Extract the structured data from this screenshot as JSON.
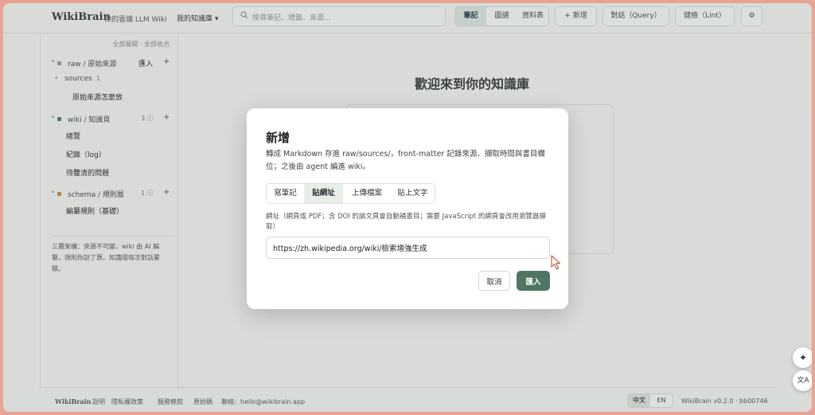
{
  "header": {
    "brand": "WikiBrain",
    "brand_sub": "你的雲端 LLM Wiki",
    "kb_select": "我的知識庫 ▾",
    "search_placeholder": "搜尋筆記、標籤、來源...",
    "views": [
      "筆記",
      "圖譜",
      "資料表"
    ],
    "add": "+ 新增",
    "chat": "對話（Query）",
    "lint": "健檢（Lint）",
    "settings_icon": "gear-icon"
  },
  "sidebar": {
    "expand_all": "全部展開",
    "collapse_all": "全部收合",
    "sep": "·",
    "raw": {
      "label": "raw / 原始來源",
      "count": "1",
      "action": "匯入",
      "color": "#9a9a9a"
    },
    "sources": {
      "label": "sources",
      "count": "1"
    },
    "raw_item": "原始來源怎麼放",
    "wiki": {
      "label": "wiki / 知識頁",
      "count": "3 ⓘ",
      "color": "#4e7663"
    },
    "wiki_items": [
      "總覽",
      "紀錄（log）",
      "待釐清的問題"
    ],
    "schema": {
      "label": "schema / 規則層",
      "count": "1 ⓘ",
      "color": "#c88a3e"
    },
    "schema_item": "編纂規則（基礎）",
    "note": "三層架構：來源不可變，wiki 由 AI 編纂，規則你說了算。知識隨每次對話累積。"
  },
  "main": {
    "welcome": "歡迎來到你的知識庫"
  },
  "footer": {
    "brand": "WikiBrain",
    "links": [
      "說明",
      "隱私權政策",
      "服務條款",
      "原始碼",
      "聯絡：hello@wikibrain.app"
    ],
    "lang": [
      "中文",
      "EN"
    ],
    "version": "WikiBrain v0.2.0 · bb00746"
  },
  "fabs": {
    "sparkle_icon": "✦",
    "translate_icon": "文A"
  },
  "modal": {
    "title": "新增",
    "description": "轉成 Markdown 存進 raw/sources/，front-matter 記錄來源、擷取時間與書目欄位；之後由 agent 編進 wiki。",
    "tabs": [
      "寫筆記",
      "貼網址",
      "上傳檔案",
      "貼上文字"
    ],
    "active_tab": "貼網址",
    "url_label": "網址（網頁或 PDF；含 DOI 的論文頁會自動補書目；需要 JavaScript 的網頁會改用瀏覽器擷取）",
    "url_value": "https://zh.wikipedia.org/wiki/檢索增強生成",
    "cancel": "取消",
    "import": "匯入"
  }
}
